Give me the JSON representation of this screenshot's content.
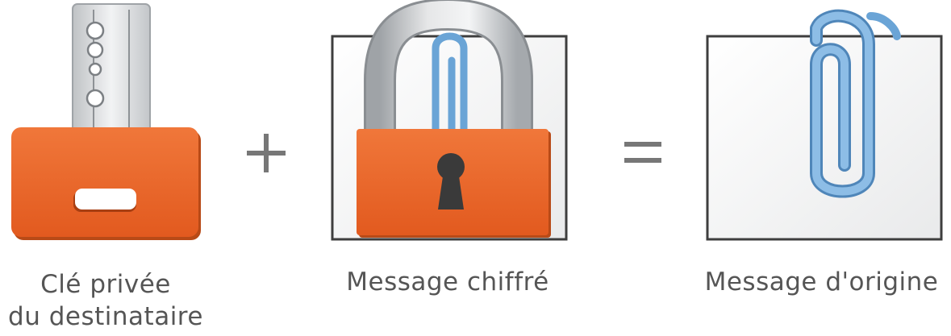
{
  "diagram": {
    "items": [
      {
        "id": "private-key",
        "label_lines": [
          "Clé privée",
          "du destinataire"
        ]
      },
      {
        "id": "encrypted-message",
        "label_lines": [
          "Message chiffré"
        ]
      },
      {
        "id": "original-message",
        "label_lines": [
          "Message d'origine"
        ]
      }
    ],
    "operators": [
      "+",
      "="
    ]
  },
  "colors": {
    "orange": "#e8642a",
    "orange_dark": "#c24e17",
    "paper": "#f3f3f3",
    "paper_border": "#444444",
    "clip_blue": "#6aa4d6",
    "metal": "#d8dadc",
    "text": "#555555",
    "operator": "#777777"
  },
  "icons": [
    "key-icon",
    "plus-icon",
    "locked-message-icon",
    "equals-icon",
    "paperclip-document-icon"
  ]
}
